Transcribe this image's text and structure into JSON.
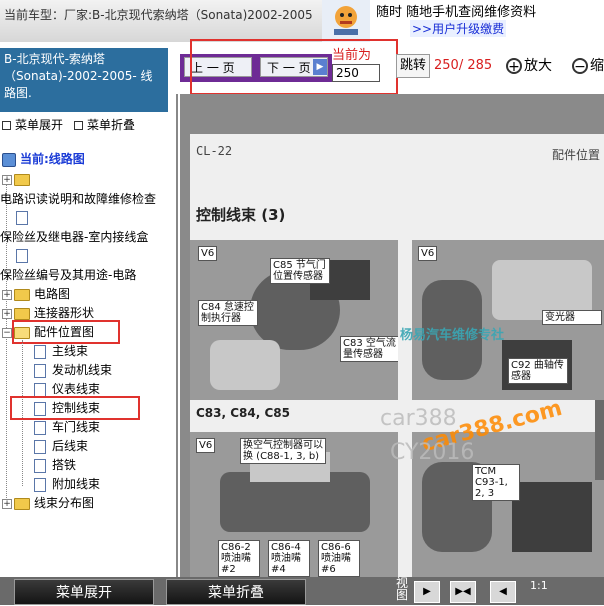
{
  "header": {
    "current_vehicle_text": "当前车型：厂家:B-北京现代索纳塔（Sonata)2002-2005",
    "promo_main": "随时 随地手机查阅维修资料",
    "promo_link": ">>用户升级缴费"
  },
  "sidebar": {
    "vehicle_title": "B-北京现代-索纳塔（Sonata)-2002-2005- 线路图.",
    "menu_expand": "菜单展开",
    "menu_collapse": "菜单折叠",
    "current_label": "当前:线路图",
    "tree": [
      {
        "label": "",
        "type": "folder",
        "level": 0
      },
      {
        "label": "电路识读说明和故障维修检查",
        "type": "text",
        "level": 0
      },
      {
        "label": "",
        "type": "doc",
        "level": 1
      },
      {
        "label": "保险丝及继电器-室内接线盒",
        "type": "text",
        "level": 0
      },
      {
        "label": "",
        "type": "doc",
        "level": 1
      },
      {
        "label": "保险丝编号及其用途-电路",
        "type": "text",
        "level": 0
      },
      {
        "label": "电路图",
        "type": "folder",
        "level": 0
      },
      {
        "label": "连接器形状",
        "type": "folder",
        "level": 0
      },
      {
        "label": "配件位置图",
        "type": "folder-open",
        "level": 0
      },
      {
        "label": "主线束",
        "type": "doc",
        "level": 1
      },
      {
        "label": "发动机线束",
        "type": "doc",
        "level": 1
      },
      {
        "label": "仪表线束",
        "type": "doc",
        "level": 1
      },
      {
        "label": "控制线束",
        "type": "doc",
        "level": 1,
        "selected": true
      },
      {
        "label": "车门线束",
        "type": "doc",
        "level": 1
      },
      {
        "label": "后线束",
        "type": "doc",
        "level": 1
      },
      {
        "label": "搭铁",
        "type": "doc",
        "level": 1
      },
      {
        "label": "附加线束",
        "type": "doc",
        "level": 1
      },
      {
        "label": "线束分布图",
        "type": "folder",
        "level": 0
      }
    ]
  },
  "toolbar": {
    "prev_label": "上 一 页",
    "next_label": "下 一 页",
    "current_label": "当前为",
    "page_input_value": "250",
    "jump_label": "跳转",
    "page_count": "250/ 285",
    "zoom_in_label": "放大",
    "zoom_out_label": "缩"
  },
  "document": {
    "page_tag": "CL-22",
    "page_category": "配件位置",
    "page_title": "控制线束 (3)",
    "photo1_tag": "V6",
    "photo2_tag": "V6",
    "photo3_tag": "V6",
    "labels": {
      "c85": "C85 节气门位置传感器",
      "c84": "C84 怠速控制执行器",
      "c83": "C83 空气流量传感器",
      "c92": "C92 曲轴传感器",
      "intake": "换空气控制器可以换 (C88-1, 3, b)",
      "c861": "C86-2 喷油嘴 #2",
      "c864": "C86-4 喷油嘴 #4",
      "c866": "C86-6 喷油嘴 #6",
      "tcm": "TCM C93-1, 2, 3",
      "misc": "变光器"
    },
    "caption": "C83, C84, C85",
    "watermark_cn": "杨易汽车维修专社",
    "watermark_url": "car388.com",
    "watermark_url2": "car388",
    "watermark_year": "CY2016"
  },
  "bottom": {
    "expand_label": "菜单展开",
    "collapse_label": "菜单折叠",
    "view_label": "视图",
    "ratio": "1:1"
  },
  "colors": {
    "vehicle_box": "#2c6e9e",
    "pager_bar": "#6e2b95",
    "alert_red": "#e0322e",
    "link_blue": "#1a2fd6"
  }
}
